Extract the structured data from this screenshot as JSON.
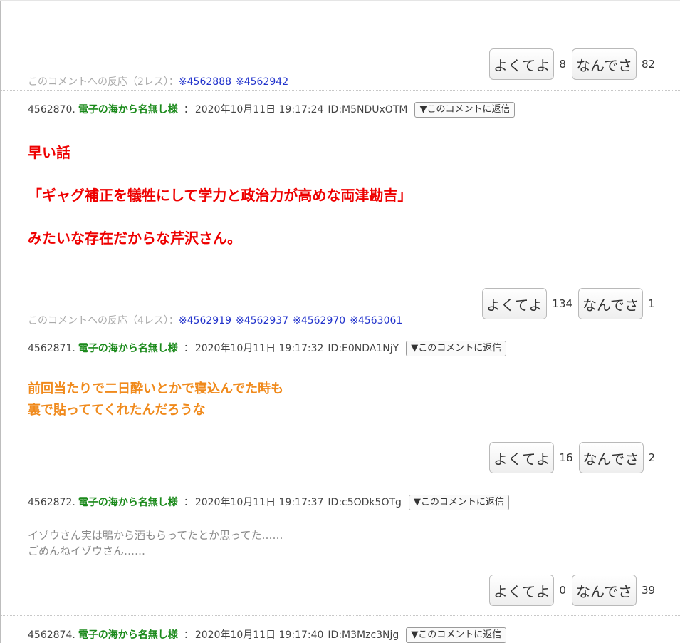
{
  "votes": [
    {
      "good_label": "よくてよ",
      "good_count": "8",
      "bad_label": "なんでさ",
      "bad_count": "82"
    },
    {
      "good_label": "よくてよ",
      "good_count": "134",
      "bad_label": "なんでさ",
      "bad_count": "1"
    },
    {
      "good_label": "よくてよ",
      "good_count": "16",
      "bad_label": "なんでさ",
      "bad_count": "2"
    },
    {
      "good_label": "よくてよ",
      "good_count": "0",
      "bad_label": "なんでさ",
      "bad_count": "39"
    }
  ],
  "reactions": [
    {
      "label": "このコメントへの反応（2レス）：",
      "links": [
        "※4562888",
        "※4562942"
      ]
    },
    {
      "label": "このコメントへの反応（4レス）：",
      "links": [
        "※4562919",
        "※4562937",
        "※4562970",
        "※4563061"
      ]
    }
  ],
  "comments": [
    {
      "number": "4562870.",
      "author": "電子の海から名無し様",
      "sep": "：",
      "date": "2020年10月11日 19:17:24",
      "uid": "ID:M5NDUxOTM",
      "reply": "▼このコメントに返信",
      "lines": [
        "早い話",
        "「ギャグ補正を犠牲にして学力と政治力が高めな両津勘吉」",
        "みたいな存在だからな芹沢さん。"
      ]
    },
    {
      "number": "4562871.",
      "author": "電子の海から名無し様",
      "sep": "：",
      "date": "2020年10月11日 19:17:32",
      "uid": "ID:E0NDA1NjY",
      "reply": "▼このコメントに返信",
      "lines": [
        "前回当たりで二日酔いとかで寝込んでた時も",
        "裏で貼っててくれたんだろうな"
      ]
    },
    {
      "number": "4562872.",
      "author": "電子の海から名無し様",
      "sep": "：",
      "date": "2020年10月11日 19:17:37",
      "uid": "ID:c5ODk5OTg",
      "reply": "▼このコメントに返信",
      "lines": [
        "イゾウさん実は鴨から酒もらってたとか思ってた……",
        "ごめんねイゾウさん……"
      ]
    },
    {
      "number": "4562874.",
      "author": "電子の海から名無し様",
      "sep": "：",
      "date": "2020年10月11日 19:17:40",
      "uid": "ID:M3Mzc3Njg",
      "reply": "▼このコメントに返信",
      "lines": []
    }
  ],
  "colors": {
    "author": "#1b8a1b",
    "red_text": "#ee0000",
    "orange_text": "#f08a1c",
    "link": "#2233cc"
  }
}
